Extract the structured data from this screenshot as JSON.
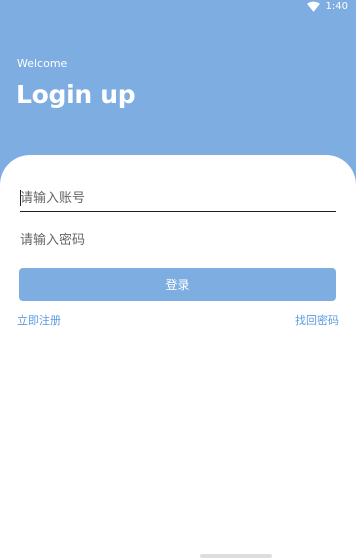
{
  "status_bar": {
    "time": "1:40"
  },
  "header": {
    "welcome": "Welcome",
    "title": "Login up"
  },
  "form": {
    "account_placeholder": "请输入账号",
    "password_placeholder": "请输入密码",
    "login_label": "登录"
  },
  "links": {
    "register": "立即注册",
    "forgot_password": "找回密码"
  },
  "colors": {
    "header_bg": "#7eade2",
    "button_bg": "#7eade2",
    "link": "#5b9be0"
  },
  "icons": {
    "status_wifi": "wifi-icon"
  }
}
